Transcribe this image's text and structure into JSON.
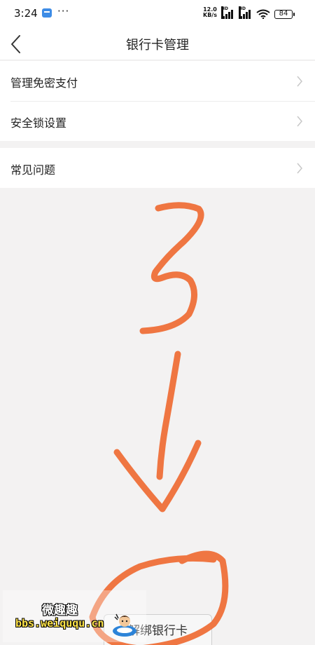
{
  "status_bar": {
    "time": "3:24",
    "more": "···",
    "net_speed_value": "12.0",
    "net_speed_unit": "KB/s",
    "signal_1_tag": "HD",
    "signal_2_tag": "HD",
    "battery": "84"
  },
  "nav": {
    "title": "银行卡管理"
  },
  "menu": {
    "items": [
      {
        "label": "管理免密支付"
      },
      {
        "label": "安全锁设置"
      },
      {
        "label": "常见问题"
      }
    ]
  },
  "bottom": {
    "unbind_label": "解绑银行卡"
  },
  "watermark": {
    "name": "微趣趣",
    "url": "bbs.weiququ.cn"
  },
  "annotation": {
    "stroke_color": "#ef7642",
    "label": "3"
  },
  "colors": {
    "background": "#f3f2f2",
    "surface": "#ffffff",
    "chevron": "#c8c8c8"
  }
}
